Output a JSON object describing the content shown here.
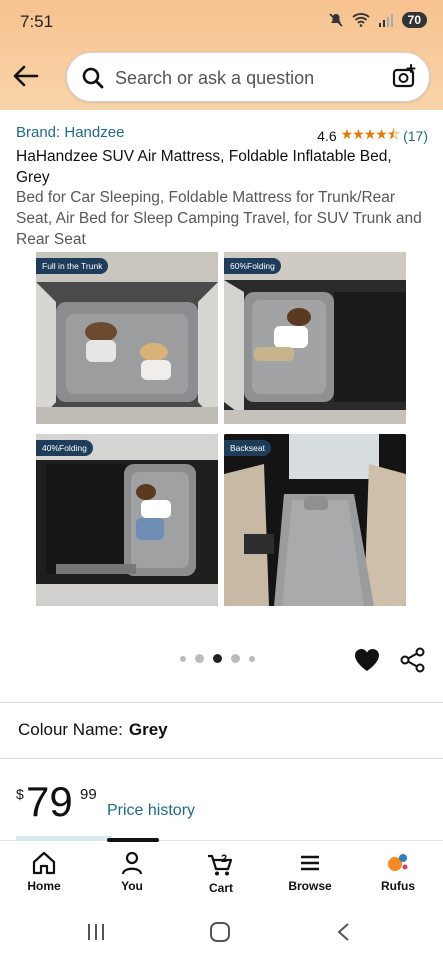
{
  "status_bar": {
    "time": "7:51",
    "battery": "70"
  },
  "header": {
    "search_placeholder": "Search or ask a question"
  },
  "product": {
    "brand": "Brand: Handzee",
    "rating": "4.6",
    "stars": "★★★★⯪",
    "review_count": "(17)",
    "title": "HaHandzee SUV Air Mattress, Foldable Inflatable Bed, Grey",
    "subtitle": "Bed for Car Sleeping, Foldable Mattress for Trunk/Rear Seat, Air Bed for Sleep Camping Travel, for SUV Trunk and Rear Seat",
    "images": [
      {
        "label": "Full in the Trunk",
        "icon": "mattress-trunk-photo"
      },
      {
        "label": "60%Folding",
        "icon": "mattress-folded-photo"
      },
      {
        "label": "40%Folding",
        "icon": "mattress-folded-photo"
      },
      {
        "label": "Backseat",
        "icon": "mattress-backseat-photo"
      }
    ],
    "carousel": {
      "count": 5,
      "active_index": 2
    },
    "colour_label": "Colour Name:",
    "colour_value": "Grey",
    "price_symbol": "$",
    "price_whole": "79",
    "price_fraction": "99",
    "price_history": "Price history"
  },
  "bottom_nav": {
    "items": [
      {
        "label": "Home",
        "icon": "home-icon"
      },
      {
        "label": "You",
        "icon": "user-icon"
      },
      {
        "label": "Cart",
        "icon": "cart-icon",
        "badge": "2"
      },
      {
        "label": "Browse",
        "icon": "menu-icon"
      },
      {
        "label": "Rufus",
        "icon": "rufus-icon"
      }
    ]
  },
  "colors": {
    "brand_link": "#1d6b8a",
    "star": "#e67a00",
    "header_gradient_top": "#f6c28f"
  }
}
